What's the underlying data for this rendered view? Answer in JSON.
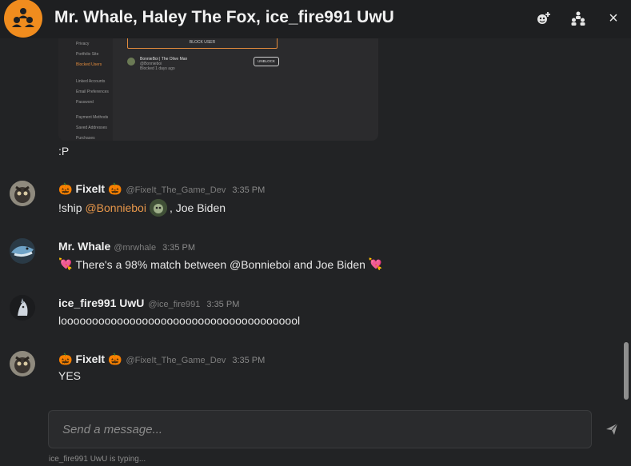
{
  "header": {
    "title": "Mr. Whale, Haley The Fox, ice_fire991 UwU",
    "icons": [
      "add-user-icon",
      "members-icon",
      "close-icon"
    ],
    "close_glyph": "×",
    "accent": "#f08c1e"
  },
  "screenshot_attachment": {
    "sidebar": [
      "Privacy",
      "Portfolio Site",
      "Blocked Users",
      "Linked Accounts",
      "Email Preferences",
      "Password",
      "Payment Methods",
      "Saved Addresses",
      "Purchases"
    ],
    "block_button": "BLOCK USER",
    "blocked_user_name": "BonnieBoi | The Olive Man",
    "blocked_user_sub": "@Bonnieboi",
    "blocked_user_time": "Blocked 1 days ago",
    "unblock_button": "UNBLOCK"
  },
  "continuation_text": ":P",
  "messages": [
    {
      "name": "FixeIt",
      "emoji_before": "🎃",
      "emoji_after": "🎃",
      "handle": "@FixeIt_The_Game_Dev",
      "time": "3:35 PM",
      "text_prefix": "!ship ",
      "mention": "@Bonnieboi",
      "text_suffix": ", Joe Biden"
    },
    {
      "name": "Mr. Whale",
      "handle": "@mrwhale",
      "time": "3:35 PM",
      "emoji_before": "💘",
      "text": "There's a 98% match between @Bonnieboi and Joe Biden",
      "emoji_after": "💘"
    },
    {
      "name": "ice_fire991 UwU",
      "handle": "@ice_fire991",
      "time": "3:35 PM",
      "text": "looooooooooooooooooooooooooooooooooooool"
    },
    {
      "name": "FixeIt",
      "emoji_before": "🎃",
      "emoji_after": "🎃",
      "handle": "@FixeIt_The_Game_Dev",
      "time": "3:35 PM",
      "text": "YES"
    }
  ],
  "composer": {
    "placeholder": "Send a message..."
  },
  "typing_indicator": "ice_fire991 UwU is typing..."
}
